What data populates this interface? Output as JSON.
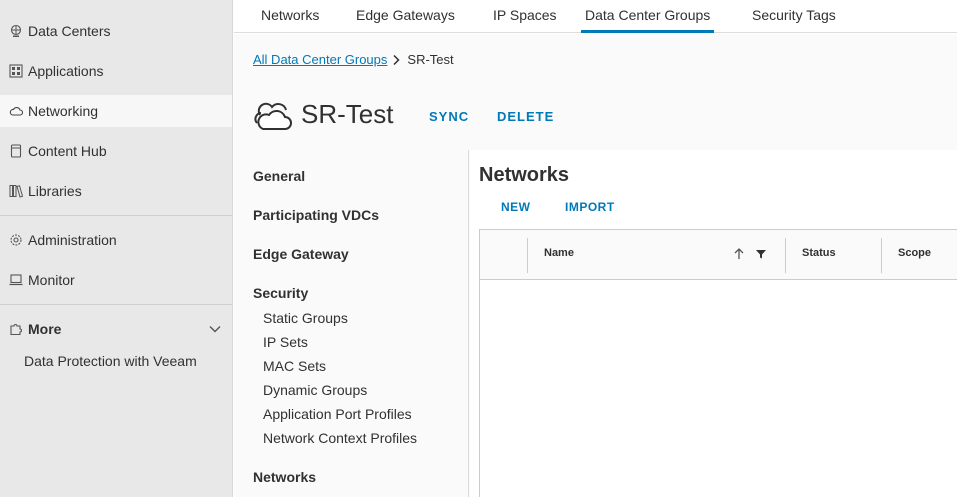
{
  "sidebar": {
    "items": [
      {
        "label": "Data Centers",
        "icon": "data-centers-icon"
      },
      {
        "label": "Applications",
        "icon": "applications-icon"
      },
      {
        "label": "Networking",
        "icon": "networking-cloud-icon"
      },
      {
        "label": "Content Hub",
        "icon": "content-hub-icon"
      },
      {
        "label": "Libraries",
        "icon": "libraries-icon"
      },
      {
        "label": "Administration",
        "icon": "administration-gear-icon"
      },
      {
        "label": "Monitor",
        "icon": "monitor-icon"
      }
    ],
    "more": {
      "label": "More",
      "icon": "more-puzzle-icon"
    },
    "more_items": [
      {
        "label": "Data Protection with Veeam"
      }
    ]
  },
  "tabs": [
    {
      "label": "Networks"
    },
    {
      "label": "Edge Gateways"
    },
    {
      "label": "IP Spaces"
    },
    {
      "label": "Data Center Groups"
    },
    {
      "label": "Security Tags"
    }
  ],
  "breadcrumb": {
    "parent": "All Data Center Groups",
    "current": "SR-Test"
  },
  "header": {
    "title": "SR-Test",
    "sync_label": "SYNC",
    "delete_label": "DELETE"
  },
  "subnav": {
    "general": "General",
    "participating_vdcs": "Participating VDCs",
    "edge_gateway": "Edge Gateway",
    "security": "Security",
    "security_items": [
      {
        "label": "Static Groups"
      },
      {
        "label": "IP Sets"
      },
      {
        "label": "MAC Sets"
      },
      {
        "label": "Dynamic Groups"
      },
      {
        "label": "Application Port Profiles"
      },
      {
        "label": "Network Context Profiles"
      }
    ],
    "networks": "Networks"
  },
  "content": {
    "title": "Networks",
    "new_label": "NEW",
    "import_label": "IMPORT",
    "columns": [
      {
        "label": "Name"
      },
      {
        "label": "Status"
      },
      {
        "label": "Scope"
      }
    ]
  },
  "colors": {
    "accent": "#0079b8",
    "sidebar_bg": "#e8e8e8",
    "text": "#313131"
  }
}
